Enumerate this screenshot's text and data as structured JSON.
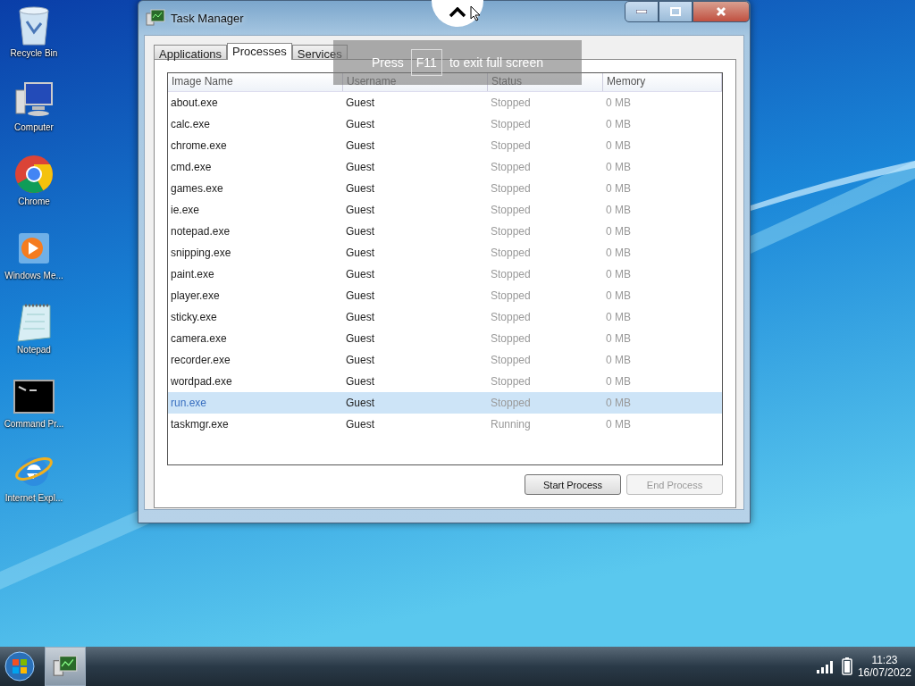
{
  "desktop_icons": [
    {
      "label": "Recycle Bin",
      "kind": "recycle"
    },
    {
      "label": "Computer",
      "kind": "computer"
    },
    {
      "label": "Chrome",
      "kind": "chrome"
    },
    {
      "label": "Windows Me...",
      "kind": "media"
    },
    {
      "label": "Notepad",
      "kind": "notepad"
    },
    {
      "label": "Command Pr...",
      "kind": "cmd"
    },
    {
      "label": "Internet Expl...",
      "kind": "ie"
    }
  ],
  "window": {
    "title": "Task Manager",
    "tabs": [
      {
        "label": "Applications",
        "selected": false
      },
      {
        "label": "Processes",
        "selected": true
      },
      {
        "label": "Services",
        "selected": false
      }
    ],
    "columns": [
      "Image Name",
      "Username",
      "Status",
      "Memory"
    ],
    "rows": [
      {
        "image_name": "about.exe",
        "username": "Guest",
        "status": "Stopped",
        "memory": "0 MB",
        "selected": false
      },
      {
        "image_name": "calc.exe",
        "username": "Guest",
        "status": "Stopped",
        "memory": "0 MB",
        "selected": false
      },
      {
        "image_name": "chrome.exe",
        "username": "Guest",
        "status": "Stopped",
        "memory": "0 MB",
        "selected": false
      },
      {
        "image_name": "cmd.exe",
        "username": "Guest",
        "status": "Stopped",
        "memory": "0 MB",
        "selected": false
      },
      {
        "image_name": "games.exe",
        "username": "Guest",
        "status": "Stopped",
        "memory": "0 MB",
        "selected": false
      },
      {
        "image_name": "ie.exe",
        "username": "Guest",
        "status": "Stopped",
        "memory": "0 MB",
        "selected": false
      },
      {
        "image_name": "notepad.exe",
        "username": "Guest",
        "status": "Stopped",
        "memory": "0 MB",
        "selected": false
      },
      {
        "image_name": "snipping.exe",
        "username": "Guest",
        "status": "Stopped",
        "memory": "0 MB",
        "selected": false
      },
      {
        "image_name": "paint.exe",
        "username": "Guest",
        "status": "Stopped",
        "memory": "0 MB",
        "selected": false
      },
      {
        "image_name": "player.exe",
        "username": "Guest",
        "status": "Stopped",
        "memory": "0 MB",
        "selected": false
      },
      {
        "image_name": "sticky.exe",
        "username": "Guest",
        "status": "Stopped",
        "memory": "0 MB",
        "selected": false
      },
      {
        "image_name": "camera.exe",
        "username": "Guest",
        "status": "Stopped",
        "memory": "0 MB",
        "selected": false
      },
      {
        "image_name": "recorder.exe",
        "username": "Guest",
        "status": "Stopped",
        "memory": "0 MB",
        "selected": false
      },
      {
        "image_name": "wordpad.exe",
        "username": "Guest",
        "status": "Stopped",
        "memory": "0 MB",
        "selected": false
      },
      {
        "image_name": "run.exe",
        "username": "Guest",
        "status": "Stopped",
        "memory": "0 MB",
        "selected": true
      },
      {
        "image_name": "taskmgr.exe",
        "username": "Guest",
        "status": "Running",
        "memory": "0 MB",
        "selected": false
      }
    ],
    "buttons": [
      {
        "label": "Start Process",
        "disabled": false
      },
      {
        "label": "End Process",
        "disabled": true
      }
    ]
  },
  "fullscreen_notice": {
    "before": "Press",
    "key": "F11",
    "after": "to exit full screen"
  },
  "taskbar": {
    "time": "11:23",
    "date": "16/07/2022"
  }
}
